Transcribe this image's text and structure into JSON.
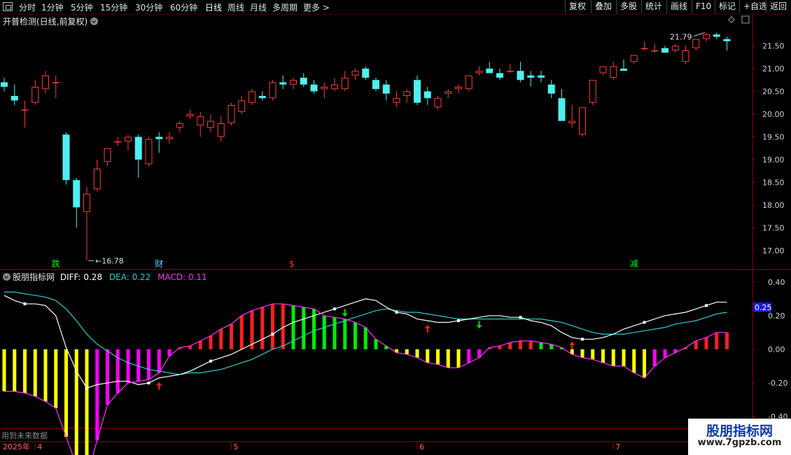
{
  "toolbar": {
    "periods": [
      "分时",
      "1分钟",
      "5分钟",
      "15分钟",
      "30分钟",
      "60分钟",
      "日线",
      "周线",
      "月线",
      "多周期",
      "更多 >"
    ],
    "active_period": "日线",
    "right_buttons": [
      "复权",
      "叠加",
      "多股",
      "统计",
      "画线",
      "F10",
      "标记",
      "+自选",
      "返回"
    ]
  },
  "price_panel": {
    "title": "开普检测(日线,前复权)",
    "high_label": "21.79",
    "low_label": "16.78",
    "markers": [
      {
        "text": "跌",
        "color": "#00ff00",
        "idx": 5
      },
      {
        "text": "财",
        "color": "#66ccff",
        "idx": 15
      },
      {
        "text": "$",
        "color": "#ff3030",
        "idx": 28
      },
      {
        "text": "减",
        "color": "#00ff00",
        "idx": 61
      }
    ]
  },
  "indicator_panel": {
    "name": "股朋指标网",
    "diff_label": "DIFF: 0.28",
    "dea_label": "DEA: 0.22",
    "macd_label": "MACD: 0.11",
    "current_value_tag": "0.25",
    "colors": {
      "diff": "#ffffff",
      "dea": "#33cccc",
      "macd": "#ff33ff",
      "up_red": "#ff2020",
      "up_green": "#00ee00",
      "down_yellow": "#ffff00",
      "down_magenta": "#ff00ff"
    }
  },
  "footer": {
    "warning": "用到未来数据",
    "year_label": "2025年",
    "months": [
      {
        "label": "4",
        "idx": 3
      },
      {
        "label": "5",
        "idx": 22
      },
      {
        "label": "6",
        "idx": 40
      },
      {
        "label": "7",
        "idx": 59
      }
    ]
  },
  "watermark": {
    "title": "股朋指标网",
    "url": "www.7gpzb.com"
  },
  "chart_data": [
    {
      "type": "candlestick",
      "title": "开普检测(日线,前复权)",
      "ylim": [
        16.6,
        22.2
      ],
      "y_ticks": [
        17.0,
        17.5,
        18.0,
        18.5,
        19.0,
        19.5,
        20.0,
        20.5,
        21.0,
        21.5
      ],
      "ohlc": [
        [
          20.7,
          20.8,
          20.5,
          20.6
        ],
        [
          20.4,
          20.65,
          20.2,
          20.3
        ],
        [
          20.1,
          20.3,
          19.7,
          20.1
        ],
        [
          20.25,
          20.75,
          20.2,
          20.6
        ],
        [
          20.55,
          20.95,
          20.45,
          20.85
        ],
        [
          20.7,
          20.85,
          20.35,
          20.7
        ],
        [
          19.55,
          19.6,
          18.45,
          18.55
        ],
        [
          18.55,
          18.6,
          17.5,
          17.95
        ],
        [
          17.85,
          18.4,
          16.78,
          18.25
        ],
        [
          18.35,
          19.0,
          18.3,
          18.8
        ],
        [
          18.95,
          19.25,
          18.85,
          19.25
        ],
        [
          19.4,
          19.5,
          19.3,
          19.4
        ],
        [
          19.4,
          19.55,
          19.2,
          19.5
        ],
        [
          19.5,
          19.55,
          18.6,
          19.0
        ],
        [
          18.9,
          19.5,
          18.85,
          19.45
        ],
        [
          19.5,
          19.6,
          19.15,
          19.45
        ],
        [
          19.45,
          19.6,
          19.35,
          19.5
        ],
        [
          19.7,
          19.85,
          19.6,
          19.8
        ],
        [
          19.95,
          20.1,
          19.9,
          20.0
        ],
        [
          19.75,
          20.05,
          19.5,
          19.95
        ],
        [
          19.7,
          20.0,
          19.6,
          19.85
        ],
        [
          19.5,
          19.95,
          19.4,
          19.8
        ],
        [
          19.8,
          20.25,
          19.75,
          20.2
        ],
        [
          20.05,
          20.4,
          20.0,
          20.3
        ],
        [
          20.25,
          20.55,
          20.2,
          20.5
        ],
        [
          20.4,
          20.5,
          20.3,
          20.35
        ],
        [
          20.35,
          20.75,
          20.3,
          20.7
        ],
        [
          20.7,
          20.85,
          20.55,
          20.65
        ],
        [
          20.65,
          20.8,
          20.55,
          20.75
        ],
        [
          20.8,
          20.9,
          20.6,
          20.65
        ],
        [
          20.65,
          20.75,
          20.45,
          20.5
        ],
        [
          20.55,
          20.7,
          20.35,
          20.6
        ],
        [
          20.55,
          20.8,
          20.5,
          20.65
        ],
        [
          20.55,
          20.95,
          20.5,
          20.8
        ],
        [
          20.85,
          21.0,
          20.75,
          20.95
        ],
        [
          21.0,
          21.05,
          20.75,
          20.8
        ],
        [
          20.75,
          20.8,
          20.5,
          20.55
        ],
        [
          20.65,
          20.75,
          20.3,
          20.45
        ],
        [
          20.25,
          20.5,
          20.15,
          20.35
        ],
        [
          20.4,
          20.55,
          20.25,
          20.5
        ],
        [
          20.75,
          20.85,
          20.2,
          20.25
        ],
        [
          20.5,
          20.6,
          20.2,
          20.35
        ],
        [
          20.15,
          20.4,
          20.1,
          20.35
        ],
        [
          20.45,
          20.55,
          20.35,
          20.5
        ],
        [
          20.55,
          20.65,
          20.45,
          20.6
        ],
        [
          20.55,
          20.85,
          20.5,
          20.85
        ],
        [
          20.9,
          21.05,
          20.85,
          20.95
        ],
        [
          21.0,
          21.15,
          20.9,
          20.9
        ],
        [
          20.9,
          21.0,
          20.75,
          20.8
        ],
        [
          20.95,
          21.1,
          20.9,
          20.95
        ],
        [
          20.95,
          21.15,
          20.7,
          20.75
        ],
        [
          20.85,
          20.95,
          20.6,
          20.8
        ],
        [
          20.85,
          20.95,
          20.7,
          20.8
        ],
        [
          20.65,
          20.75,
          20.35,
          20.45
        ],
        [
          20.35,
          20.55,
          19.85,
          19.85
        ],
        [
          19.8,
          20.2,
          19.7,
          19.85
        ],
        [
          19.55,
          20.15,
          19.5,
          20.15
        ],
        [
          20.25,
          20.75,
          20.2,
          20.75
        ],
        [
          20.9,
          21.05,
          20.85,
          21.05
        ],
        [
          20.8,
          21.15,
          20.75,
          21.05
        ],
        [
          21.0,
          21.2,
          20.95,
          20.95
        ],
        [
          21.15,
          21.3,
          21.1,
          21.3
        ],
        [
          21.45,
          21.6,
          21.4,
          21.45
        ],
        [
          21.4,
          21.55,
          21.35,
          21.4
        ],
        [
          21.45,
          21.5,
          21.35,
          21.35
        ],
        [
          21.4,
          21.55,
          21.35,
          21.5
        ],
        [
          21.15,
          21.5,
          21.1,
          21.4
        ],
        [
          21.45,
          21.65,
          21.4,
          21.65
        ],
        [
          21.65,
          21.79,
          21.6,
          21.75
        ],
        [
          21.75,
          21.79,
          21.65,
          21.7
        ],
        [
          21.65,
          21.7,
          21.4,
          21.6
        ]
      ]
    },
    {
      "type": "macd",
      "title": "股朋指标网",
      "ylim": [
        -0.47,
        0.47
      ],
      "y_ticks": [
        0.4,
        0.2,
        0.0,
        -0.2,
        -0.4
      ],
      "series": [
        {
          "name": "DIFF",
          "values": [
            0.32,
            0.29,
            0.27,
            0.27,
            0.26,
            0.2,
            0.01,
            -0.13,
            -0.23,
            -0.21,
            -0.2,
            -0.19,
            -0.19,
            -0.21,
            -0.2,
            -0.17,
            -0.16,
            -0.15,
            -0.13,
            -0.1,
            -0.07,
            -0.05,
            -0.03,
            0.0,
            0.03,
            0.06,
            0.09,
            0.13,
            0.16,
            0.18,
            0.2,
            0.22,
            0.24,
            0.26,
            0.28,
            0.3,
            0.29,
            0.25,
            0.22,
            0.21,
            0.18,
            0.17,
            0.16,
            0.16,
            0.17,
            0.18,
            0.19,
            0.2,
            0.2,
            0.19,
            0.19,
            0.17,
            0.16,
            0.14,
            0.1,
            0.07,
            0.06,
            0.06,
            0.07,
            0.09,
            0.12,
            0.14,
            0.16,
            0.18,
            0.2,
            0.21,
            0.22,
            0.24,
            0.26,
            0.28,
            0.28
          ]
        },
        {
          "name": "DEA",
          "values": [
            0.34,
            0.34,
            0.33,
            0.32,
            0.31,
            0.29,
            0.24,
            0.17,
            0.09,
            0.03,
            -0.01,
            -0.05,
            -0.08,
            -0.1,
            -0.12,
            -0.13,
            -0.14,
            -0.15,
            -0.14,
            -0.14,
            -0.13,
            -0.12,
            -0.1,
            -0.08,
            -0.06,
            -0.03,
            0.0,
            0.02,
            0.05,
            0.08,
            0.11,
            0.13,
            0.15,
            0.17,
            0.19,
            0.21,
            0.23,
            0.24,
            0.23,
            0.22,
            0.22,
            0.21,
            0.2,
            0.19,
            0.18,
            0.18,
            0.18,
            0.18,
            0.18,
            0.18,
            0.18,
            0.18,
            0.18,
            0.17,
            0.16,
            0.14,
            0.12,
            0.1,
            0.09,
            0.09,
            0.09,
            0.1,
            0.11,
            0.12,
            0.13,
            0.15,
            0.16,
            0.17,
            0.19,
            0.21,
            0.22
          ]
        },
        {
          "name": "MACD",
          "values": [
            -0.25,
            -0.25,
            -0.26,
            -0.28,
            -0.31,
            -0.35,
            -0.52,
            -0.69,
            -0.76,
            -0.54,
            -0.33,
            -0.26,
            -0.2,
            -0.19,
            -0.18,
            -0.14,
            -0.04,
            0.01,
            0.02,
            0.05,
            0.08,
            0.12,
            0.15,
            0.2,
            0.23,
            0.25,
            0.27,
            0.27,
            0.26,
            0.25,
            0.24,
            0.2,
            0.19,
            0.18,
            0.16,
            0.13,
            0.06,
            0.02,
            -0.02,
            -0.03,
            -0.05,
            -0.08,
            -0.09,
            -0.11,
            -0.11,
            -0.08,
            -0.05,
            0.01,
            0.02,
            0.04,
            0.05,
            0.05,
            0.04,
            0.03,
            0.01,
            -0.03,
            -0.05,
            -0.06,
            -0.08,
            -0.1,
            -0.1,
            -0.14,
            -0.17,
            -0.1,
            -0.05,
            -0.02,
            0.01,
            0.05,
            0.07,
            0.1,
            0.1
          ]
        }
      ],
      "signals": [
        {
          "type": "up",
          "idx": 15
        },
        {
          "type": "down",
          "idx": 33
        },
        {
          "type": "up",
          "idx": 41
        },
        {
          "type": "down",
          "idx": 46
        },
        {
          "type": "up",
          "idx": 55
        }
      ]
    }
  ]
}
